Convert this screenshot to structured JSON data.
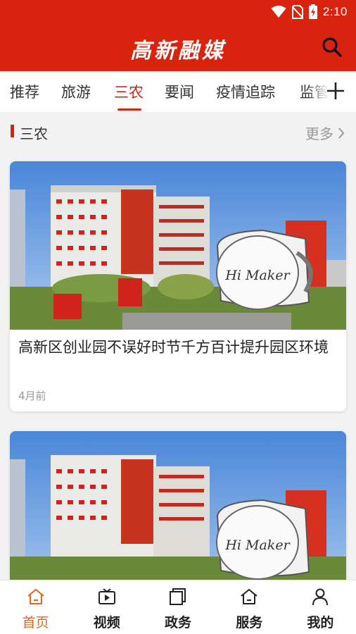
{
  "status_bar": {
    "time": "2:10",
    "icons": [
      "wifi-icon",
      "no-sim-icon",
      "battery-charging-icon"
    ]
  },
  "header": {
    "title": "高新融媒",
    "search_icon": "search-icon"
  },
  "tabs": [
    {
      "label": "推荐",
      "active": false
    },
    {
      "label": "旅游",
      "active": false
    },
    {
      "label": "三农",
      "active": true
    },
    {
      "label": "要闻",
      "active": false
    },
    {
      "label": "疫情追踪",
      "active": false
    },
    {
      "label": "监管",
      "active": false
    }
  ],
  "tab_add_icon": "plus-icon",
  "section": {
    "title": "三农",
    "more_label": "更多"
  },
  "articles": [
    {
      "title": "高新区创业园不误好时节千方百计提升园区环境",
      "time": "4月前",
      "image_sign": "Hi Maker"
    },
    {
      "title": "",
      "time": "",
      "image_sign": "Hi Maker"
    }
  ],
  "bottom_nav": [
    {
      "label": "首页",
      "icon": "home-icon",
      "active": true
    },
    {
      "label": "视频",
      "icon": "video-icon",
      "active": false
    },
    {
      "label": "政务",
      "icon": "documents-icon",
      "active": false
    },
    {
      "label": "服务",
      "icon": "service-home-icon",
      "active": false
    },
    {
      "label": "我的",
      "icon": "user-icon",
      "active": false
    }
  ],
  "colors": {
    "brand": "#d8230f",
    "nav_active": "#e2661a",
    "text": "#222222",
    "muted": "#999999"
  }
}
